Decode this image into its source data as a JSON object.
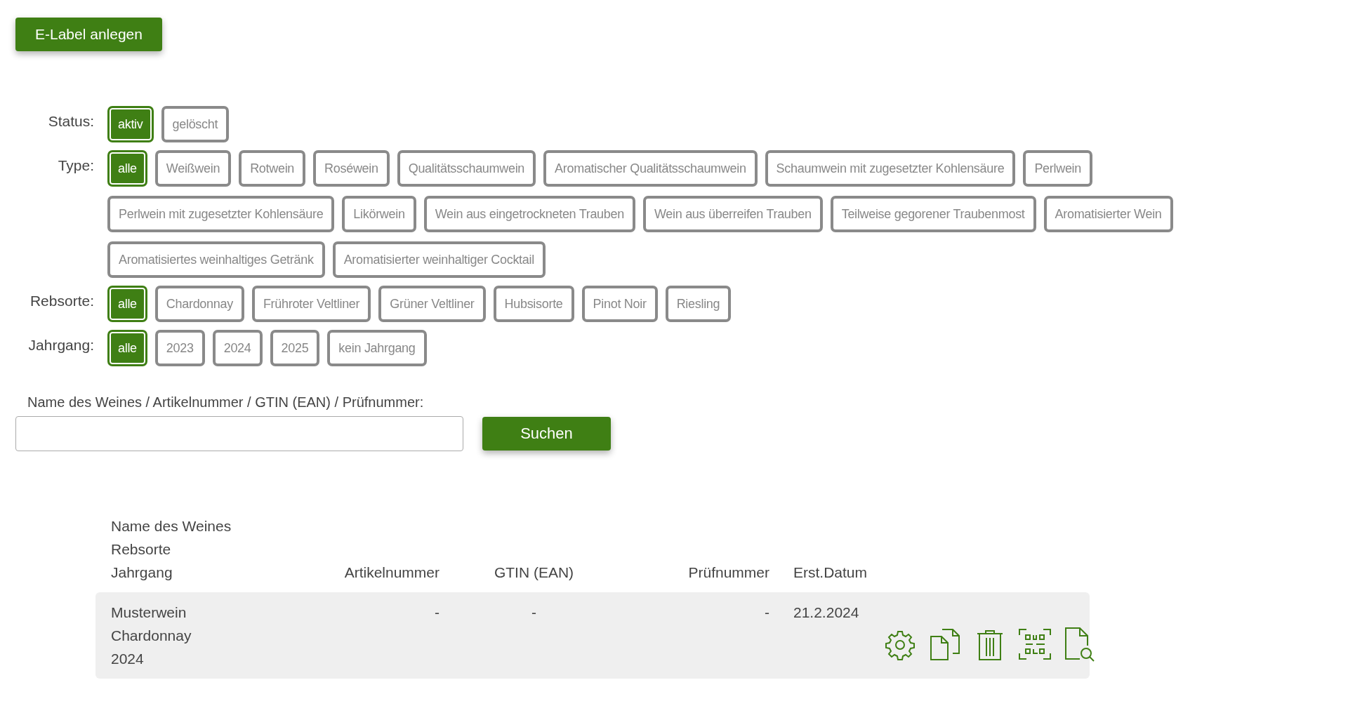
{
  "create_button": "E-Label anlegen",
  "filters": [
    {
      "label": "Status:",
      "options": [
        {
          "label": "aktiv",
          "selected": true
        },
        {
          "label": "gelöscht",
          "selected": false
        }
      ]
    },
    {
      "label": "Type:",
      "options": [
        {
          "label": "alle",
          "selected": true
        },
        {
          "label": "Weißwein",
          "selected": false
        },
        {
          "label": "Rotwein",
          "selected": false
        },
        {
          "label": "Roséwein",
          "selected": false
        },
        {
          "label": "Qualitätsschaumwein",
          "selected": false
        },
        {
          "label": "Aromatischer Qualitätsschaumwein",
          "selected": false
        },
        {
          "label": "Schaumwein mit zugesetzter Kohlensäure",
          "selected": false
        },
        {
          "label": "Perlwein",
          "selected": false
        },
        {
          "label": "Perlwein mit zugesetzter Kohlensäure",
          "selected": false
        },
        {
          "label": "Likörwein",
          "selected": false
        },
        {
          "label": "Wein aus eingetrockneten Trauben",
          "selected": false
        },
        {
          "label": "Wein aus überreifen Trauben",
          "selected": false
        },
        {
          "label": "Teilweise gegorener Traubenmost",
          "selected": false
        },
        {
          "label": "Aromatisierter Wein",
          "selected": false
        },
        {
          "label": "Aromatisiertes weinhaltiges Getränk",
          "selected": false
        },
        {
          "label": "Aromatisierter weinhaltiger Cocktail",
          "selected": false
        }
      ]
    },
    {
      "label": "Rebsorte:",
      "options": [
        {
          "label": "alle",
          "selected": true
        },
        {
          "label": "Chardonnay",
          "selected": false
        },
        {
          "label": "Frühroter Veltliner",
          "selected": false
        },
        {
          "label": "Grüner Veltliner",
          "selected": false
        },
        {
          "label": "Hubsisorte",
          "selected": false
        },
        {
          "label": "Pinot Noir",
          "selected": false
        },
        {
          "label": "Riesling",
          "selected": false
        }
      ]
    },
    {
      "label": "Jahrgang:",
      "options": [
        {
          "label": "alle",
          "selected": true
        },
        {
          "label": "2023",
          "selected": false
        },
        {
          "label": "2024",
          "selected": false
        },
        {
          "label": "2025",
          "selected": false
        },
        {
          "label": "kein Jahrgang",
          "selected": false
        }
      ]
    }
  ],
  "search": {
    "label": "Name des Weines / Artikelnummer / GTIN (EAN) / Prüfnummer:",
    "button": "Suchen"
  },
  "table": {
    "columns": [
      "Name des Weines\nRebsorte\nJahrgang",
      "Artikelnummer",
      "GTIN (EAN)",
      "Prüfnummer",
      "Erst.Datum"
    ],
    "rows": [
      {
        "cells": [
          "Musterwein\nChardonnay\n2024",
          "-",
          "-",
          "-",
          "21.2.2024"
        ]
      }
    ]
  }
}
